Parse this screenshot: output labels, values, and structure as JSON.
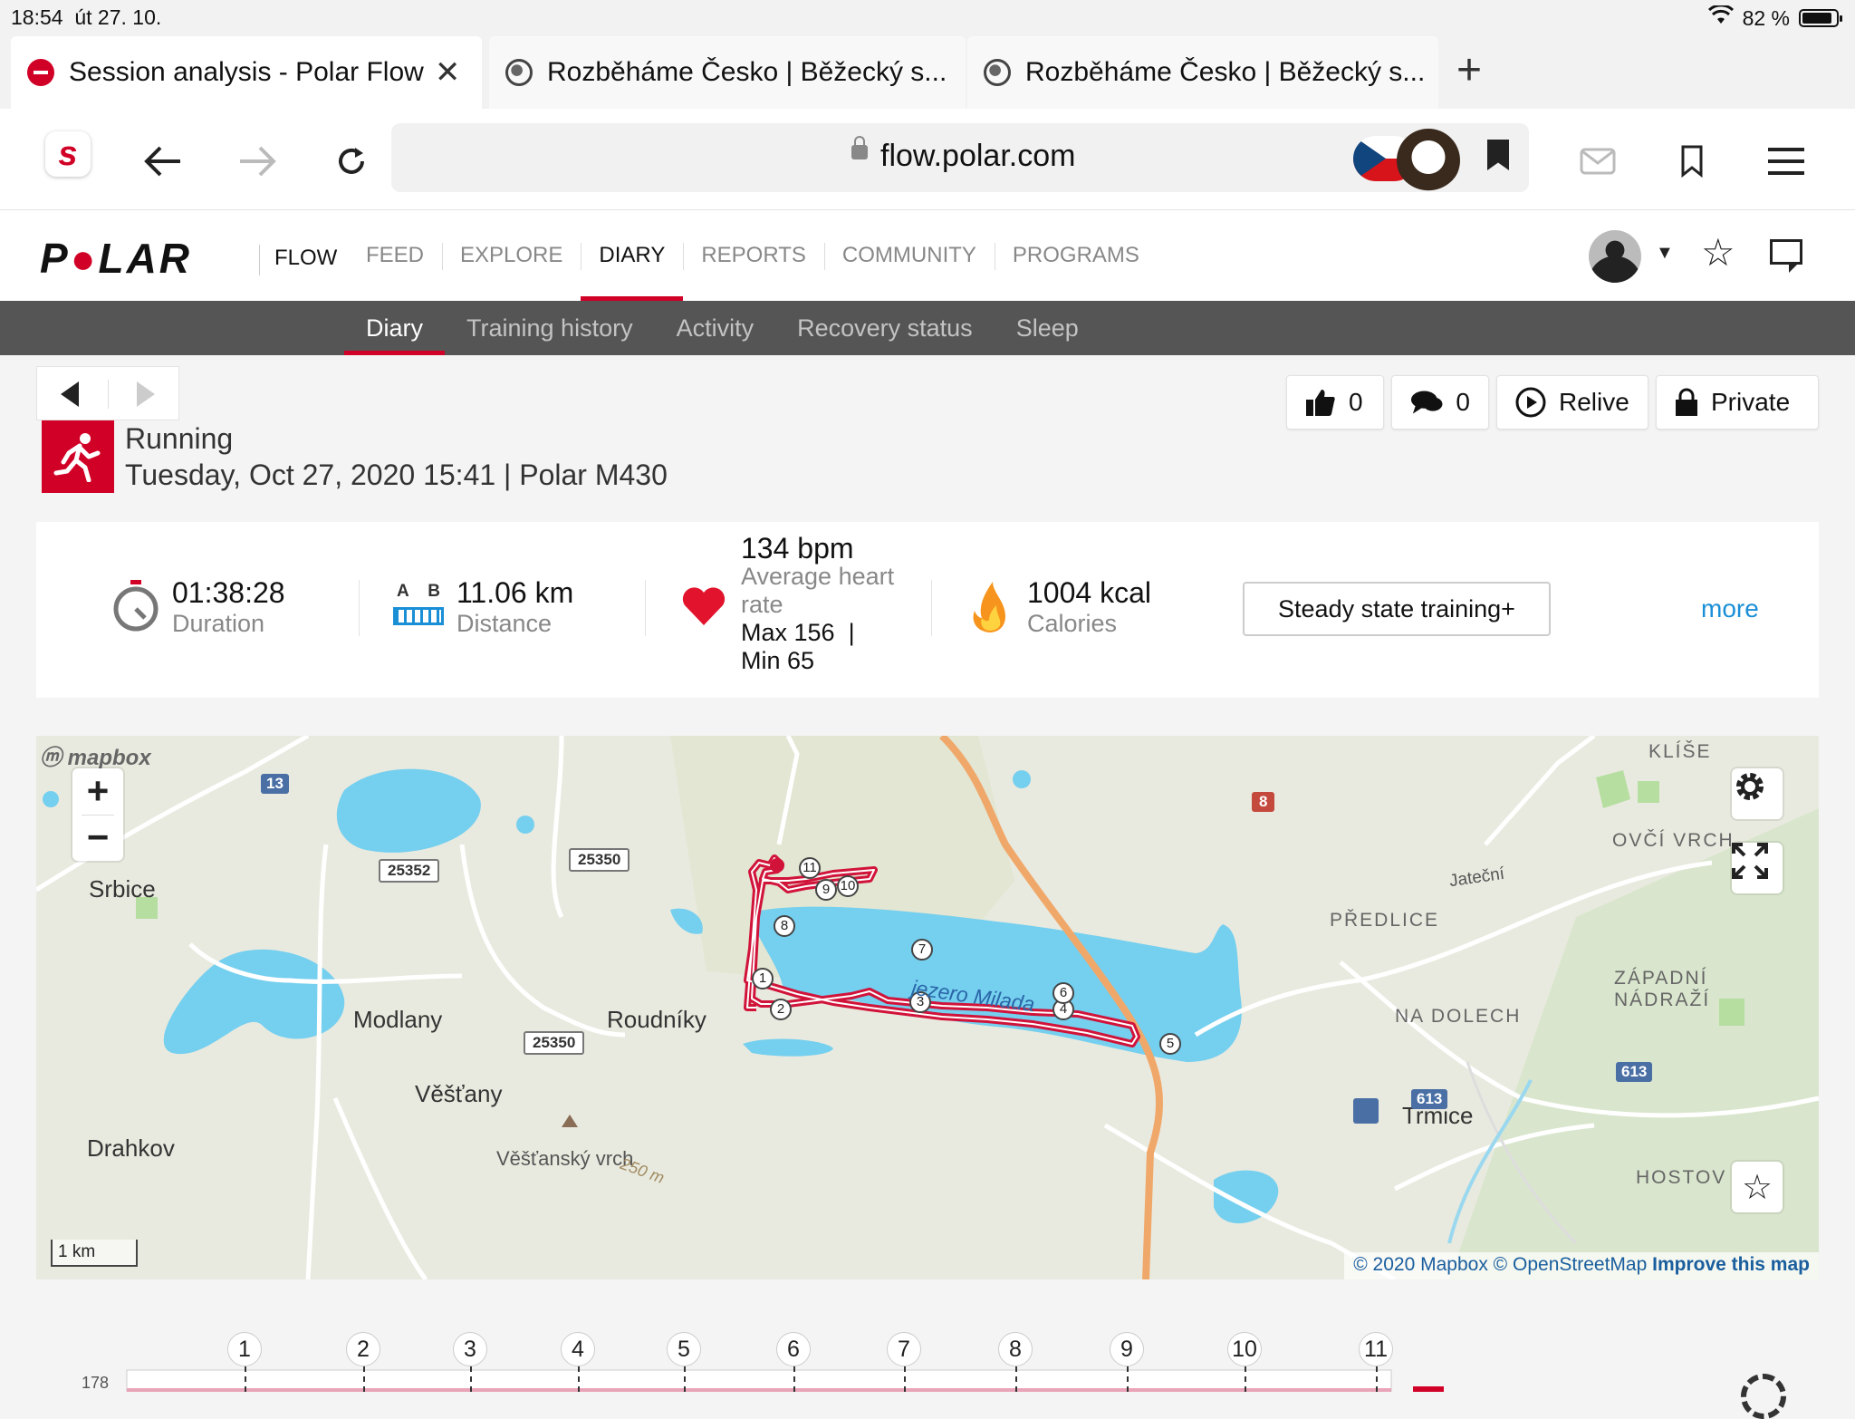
{
  "status_bar": {
    "time": "18:54",
    "date": "út 27. 10.",
    "battery": "82 %"
  },
  "browser": {
    "tabs": [
      {
        "title": "Session analysis - Polar Flow",
        "icon": "polar-favicon",
        "active": true
      },
      {
        "title": "Rozběháme Česko | Běžecký s...",
        "icon": "globe-icon",
        "active": false
      },
      {
        "title": "Rozběháme Česko | Běžecký s...",
        "icon": "globe-icon",
        "active": false
      }
    ],
    "url": "flow.polar.com",
    "close_glyph": "✕",
    "new_tab_glyph": "+"
  },
  "polar_header": {
    "logo": "POLAR",
    "product": "FLOW",
    "nav": [
      {
        "label": "FEED",
        "active": false
      },
      {
        "label": "EXPLORE",
        "active": false
      },
      {
        "label": "DIARY",
        "active": true
      },
      {
        "label": "REPORTS",
        "active": false
      },
      {
        "label": "COMMUNITY",
        "active": false
      },
      {
        "label": "PROGRAMS",
        "active": false
      }
    ]
  },
  "sub_nav": [
    {
      "label": "Diary",
      "active": true
    },
    {
      "label": "Training history",
      "active": false
    },
    {
      "label": "Activity",
      "active": false
    },
    {
      "label": "Recovery status",
      "active": false
    },
    {
      "label": "Sleep",
      "active": false
    }
  ],
  "actions": {
    "likes": "0",
    "comments": "0",
    "relive": "Relive",
    "privacy": "Private"
  },
  "session": {
    "sport": "Running",
    "datetime_device": "Tuesday, Oct 27, 2020 15:41 | Polar M430"
  },
  "summary": {
    "duration_value": "01:38:28",
    "duration_label": "Duration",
    "distance_value": "11.06 km",
    "distance_label": "Distance",
    "ab_a": "A",
    "ab_b": "B",
    "hr_value": "134 bpm",
    "hr_label_1": "Average heart",
    "hr_label_2": "rate",
    "hr_max": "Max 156",
    "hr_sep": "|",
    "hr_min": "Min 65",
    "calories_value": "1004 kcal",
    "calories_label": "Calories",
    "training_benefit": "Steady state training+",
    "more": "more"
  },
  "map": {
    "mapbox": "mapbox",
    "zoom_in": "+",
    "zoom_out": "−",
    "scale": "1 km",
    "attribution_1": "© 2020 Mapbox",
    "attribution_sep": "©",
    "attribution_2": "OpenStreetMap",
    "attribution_3": "Improve this map",
    "lake_label": "jezero Milada",
    "places": [
      "Srbice",
      "Modlany",
      "Roudníky",
      "Věšťany",
      "Drahkov",
      "Věšťanský vrch",
      "Trmice",
      "PŘEDLICE",
      "NA DOLECH",
      "ZÁPADNÍ",
      "NÁDRAŽÍ",
      "OVČÍ VRCH",
      "KLÍŠE",
      "HOSTOV",
      "Jateční",
      "250 m"
    ],
    "roads": [
      "13",
      "25352",
      "25350",
      "25350",
      "8",
      "613",
      "613"
    ],
    "km_markers": [
      "1",
      "2",
      "3",
      "4",
      "5",
      "6",
      "7",
      "8",
      "9",
      "10",
      "11"
    ],
    "route_color": "#d1133a",
    "water_color": "#75cfef"
  },
  "chart_strip": {
    "km_labels": [
      "1",
      "2",
      "3",
      "4",
      "5",
      "6",
      "7",
      "8",
      "9",
      "10",
      "11"
    ],
    "y_top_label": "178"
  }
}
